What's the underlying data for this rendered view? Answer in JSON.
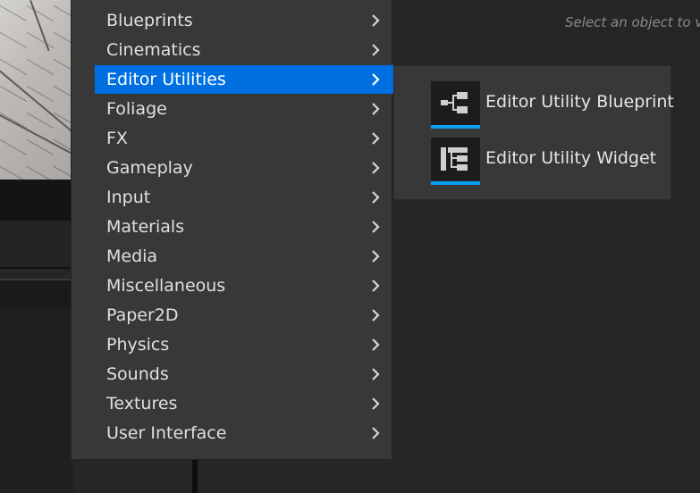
{
  "details_panel": {
    "hint": "Select an object to vie"
  },
  "menu": {
    "selected_index": 2,
    "items": [
      {
        "label": "Blueprints"
      },
      {
        "label": "Cinematics"
      },
      {
        "label": "Editor Utilities"
      },
      {
        "label": "Foliage"
      },
      {
        "label": "FX"
      },
      {
        "label": "Gameplay"
      },
      {
        "label": "Input"
      },
      {
        "label": "Materials"
      },
      {
        "label": "Media"
      },
      {
        "label": "Miscellaneous"
      },
      {
        "label": "Paper2D"
      },
      {
        "label": "Physics"
      },
      {
        "label": "Sounds"
      },
      {
        "label": "Textures"
      },
      {
        "label": "User Interface"
      }
    ],
    "chevron_icon": "chevron-right-icon"
  },
  "submenu": {
    "items": [
      {
        "label": "Editor Utility Blueprint",
        "icon": "blueprint-icon"
      },
      {
        "label": "Editor Utility Widget",
        "icon": "widget-icon"
      }
    ]
  },
  "colors": {
    "menu_bg": "#383838",
    "selected_bg": "#0070e0",
    "thumb_accent": "#0aa0f0",
    "background": "#262626"
  }
}
